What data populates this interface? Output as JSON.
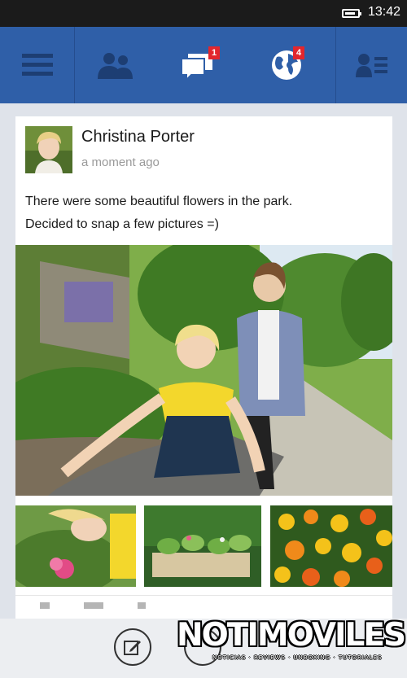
{
  "status_bar": {
    "time": "13:42"
  },
  "nav": {
    "messages_badge": "1",
    "notifications_badge": "4",
    "accent_color": "#2f5fa8",
    "badge_color": "#e2262d"
  },
  "post": {
    "author": "Christina Porter",
    "timestamp": "a moment ago",
    "text_lines": [
      "There were some beautiful flowers in the park.",
      "Decided to snap a few pictures =)"
    ]
  },
  "watermark": {
    "title": "NOTIMOVILES",
    "tagline": "NOTICIAS · REVIEWS · UNBOXING · TUTORIALES"
  }
}
